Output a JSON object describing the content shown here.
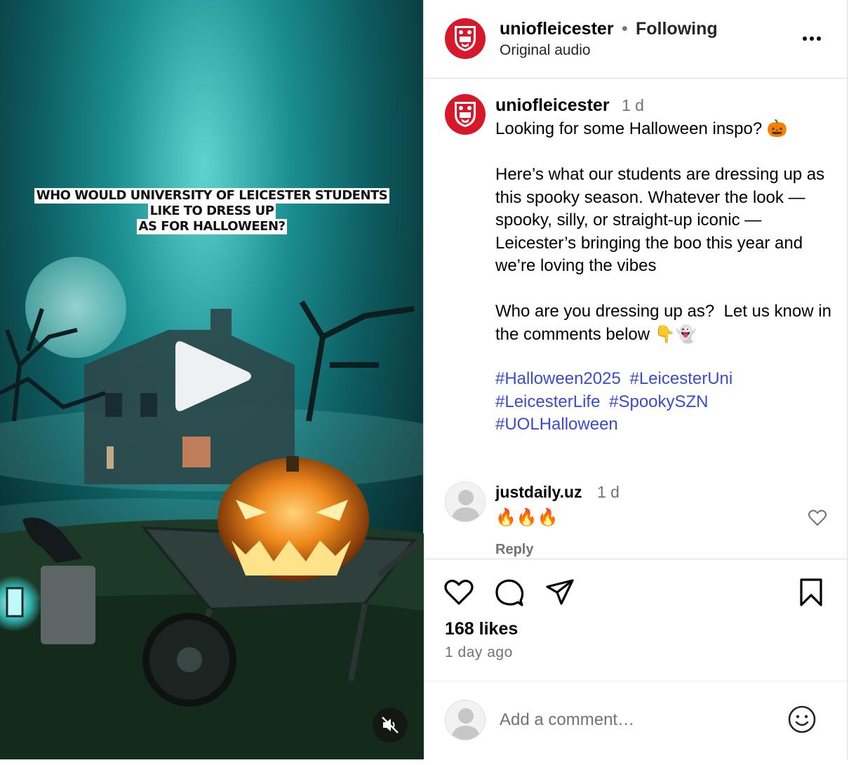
{
  "post": {
    "overlay_lines": [
      "WHO WOULD UNIVERSITY OF LEICESTER STUDENTS",
      "LIKE TO DRESS UP",
      "AS FOR HALLOWEEN?"
    ]
  },
  "header": {
    "username": "uniofleicester",
    "separator": "•",
    "following": "Following",
    "audio": "Original audio"
  },
  "caption": {
    "username": "uniofleicester",
    "time": "1 d",
    "body": "Looking for some Halloween inspo? 🎃\n\nHere’s what our students are dressing up as this spooky season. Whatever the look — spooky, silly, or straight-up iconic — Leicester’s bringing the boo this year and we’re loving the vibes\n\nWho are you dressing up as?  Let us know in the comments below 👇👻",
    "hashtags": [
      "#Halloween2025",
      "#LeicesterUni",
      "#LeicesterLife",
      "#SpookySZN",
      "#UOLHalloween"
    ]
  },
  "comment": {
    "username": "justdaily.uz",
    "time": "1 d",
    "text": "🔥🔥🔥",
    "reply_label": "Reply"
  },
  "stats": {
    "likes": "168 likes",
    "posted": "1 day ago"
  },
  "add_comment": {
    "placeholder": "Add a comment…"
  },
  "colors": {
    "brand_red": "#d7182a",
    "link_blue": "#3a4bd3",
    "muted": "#737373"
  },
  "icons": [
    "play-icon",
    "mute-icon",
    "more-icon",
    "heart-icon",
    "comment-icon",
    "share-icon",
    "bookmark-icon",
    "emoji-icon",
    "university-crest-icon",
    "default-avatar-icon"
  ]
}
